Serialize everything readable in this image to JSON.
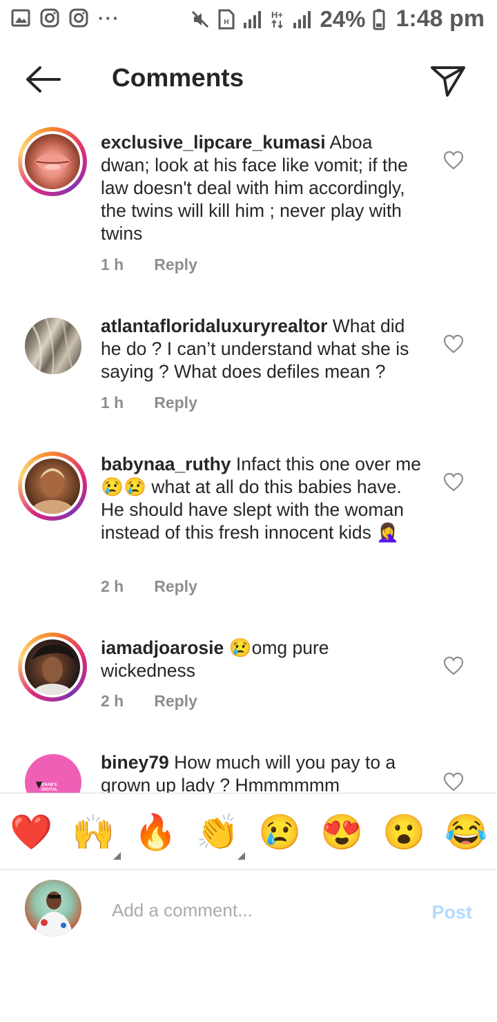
{
  "status_bar": {
    "left_icons": [
      "gallery-icon",
      "instagram-icon",
      "instagram-icon",
      "more-notifications-icon"
    ],
    "more": "···",
    "battery": "24%",
    "time": "1:48 pm",
    "right_icons": [
      "mute-icon",
      "sim-icon",
      "signal-icon",
      "hplus-data-icon",
      "signal-icon",
      "battery-icon"
    ]
  },
  "header": {
    "title": "Comments",
    "back_icon": "arrow-left-icon",
    "share_icon": "direct-send-icon"
  },
  "comments": [
    {
      "username": "exclusive_lipcare_kumasi",
      "text": "Aboa dwan; look at his face like vomit; if the  law doesn't deal with him accordingly,  the twins will kill him ; never play with twins",
      "time": "1 h",
      "reply": "Reply",
      "avatar": "lips-photo",
      "story_ring": true
    },
    {
      "username": "atlantafloridaluxuryrealtor",
      "text": "What did he do ? I can’t understand what she is saying ? What does defiles mean ?",
      "time": "1 h",
      "reply": "Reply",
      "avatar": "blonde-hair-photo",
      "story_ring": false
    },
    {
      "username": "babynaa_ruthy",
      "text": "Infact this one over me 😢😢 what at all do this babies have. He should have slept with the woman instead of this fresh innocent kids 🤦‍♀️",
      "time": "2 h",
      "reply": "Reply",
      "avatar": "woman-portrait-photo",
      "story_ring": true
    },
    {
      "username": "iamadjoarosie",
      "text": "😢omg pure wickedness",
      "time": "2 h",
      "reply": "Reply",
      "avatar": "woman-glam-photo",
      "story_ring": true
    },
    {
      "username": "biney79",
      "text": "How much will you pay to a grown  up lady ? Hmmmmmm",
      "time": "",
      "reply": "",
      "avatar": "enabs-digital-services-logo",
      "avatar_text": "ENAB'S DIGITAL SERVICES",
      "story_ring": false
    }
  ],
  "quick_reactions": [
    {
      "emoji": "❤️",
      "name": "red-heart"
    },
    {
      "emoji": "🙌",
      "name": "raising-hands",
      "has_variants": true
    },
    {
      "emoji": "🔥",
      "name": "fire"
    },
    {
      "emoji": "👏",
      "name": "clapping-hands",
      "has_variants": true
    },
    {
      "emoji": "😢",
      "name": "crying-face"
    },
    {
      "emoji": "😍",
      "name": "heart-eyes"
    },
    {
      "emoji": "😮",
      "name": "open-mouth"
    },
    {
      "emoji": "😂",
      "name": "tears-of-joy"
    }
  ],
  "composer": {
    "placeholder": "Add a comment...",
    "post_label": "Post",
    "avatar": "current-user-photo"
  },
  "colors": {
    "text": "#262626",
    "meta": "#8e8e8e",
    "post_disabled": "#b3dbff",
    "status_icons": "#5a5a5a"
  }
}
